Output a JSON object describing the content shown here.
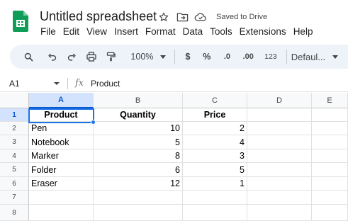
{
  "app": {
    "title": "Untitled spreadsheet",
    "saved_status": "Saved to Drive",
    "icons": [
      "sheets-logo-icon",
      "star-icon",
      "move-to-folder-icon",
      "cloud-saved-icon"
    ]
  },
  "menu": {
    "items": [
      "File",
      "Edit",
      "View",
      "Insert",
      "Format",
      "Data",
      "Tools",
      "Extensions",
      "Help"
    ]
  },
  "toolbar": {
    "zoom": "100%",
    "currency_label": "$",
    "percent_label": "%",
    "decrease_decimal_label": ".0",
    "increase_decimal_label": ".00",
    "number_format_label": "123",
    "font_label": "Defaul..."
  },
  "formula_bar": {
    "cell_ref": "A1",
    "fx_label": "fx",
    "content": "Product"
  },
  "grid": {
    "columns": [
      "A",
      "B",
      "C",
      "D",
      "E"
    ],
    "row_numbers": [
      "1",
      "2",
      "3",
      "4",
      "5",
      "6",
      "7",
      "8"
    ],
    "header": [
      "Product",
      "Quantity",
      "Price"
    ],
    "rows": [
      [
        "Pen",
        "10",
        "2"
      ],
      [
        "Notebook",
        "5",
        "4"
      ],
      [
        "Marker",
        "8",
        "3"
      ],
      [
        "Folder",
        "6",
        "5"
      ],
      [
        "Eraser",
        "12",
        "1"
      ]
    ]
  },
  "colors": {
    "accent": "#0b57d0",
    "selection": "#1a73e8",
    "toolbar_bg": "#eef2f9",
    "header_bg": "#f8f9fa",
    "selected_header_bg": "#d3e3fd",
    "sheets_green": "#0f9d58"
  }
}
